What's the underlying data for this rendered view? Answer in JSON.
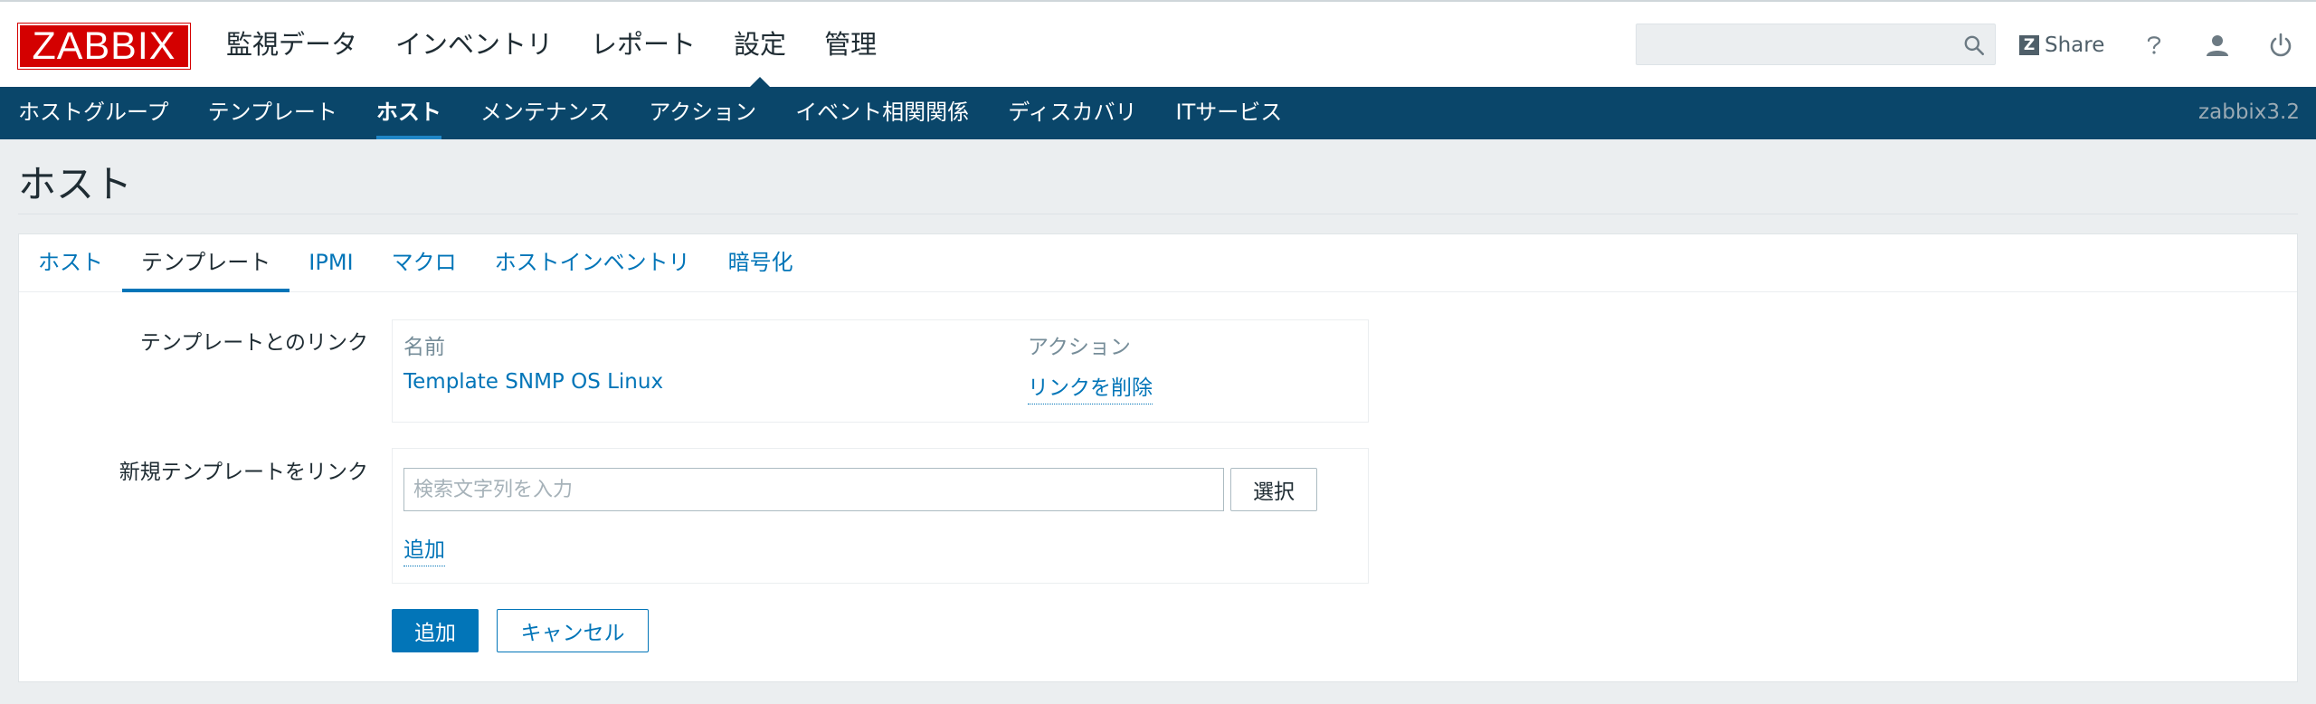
{
  "header": {
    "logo_text": "ZABBIX",
    "main_menu": [
      {
        "label": "監視データ"
      },
      {
        "label": "インベントリ"
      },
      {
        "label": "レポート"
      },
      {
        "label": "設定",
        "active": true
      },
      {
        "label": "管理"
      }
    ],
    "search": {
      "value": "",
      "placeholder": ""
    },
    "share_label": "Share",
    "help_icon": "question-mark",
    "user_icon": "person",
    "logout_icon": "power"
  },
  "submenu": {
    "items": [
      {
        "label": "ホストグループ"
      },
      {
        "label": "テンプレート"
      },
      {
        "label": "ホスト",
        "active": true
      },
      {
        "label": "メンテナンス"
      },
      {
        "label": "アクション"
      },
      {
        "label": "イベント相関関係"
      },
      {
        "label": "ディスカバリ"
      },
      {
        "label": "ITサービス"
      }
    ],
    "server_name": "zabbix3.2"
  },
  "page": {
    "title": "ホスト",
    "tabs": [
      {
        "label": "ホスト"
      },
      {
        "label": "テンプレート",
        "active": true
      },
      {
        "label": "IPMI"
      },
      {
        "label": "マクロ"
      },
      {
        "label": "ホストインベントリ"
      },
      {
        "label": "暗号化"
      }
    ]
  },
  "form": {
    "linked_templates": {
      "label": "テンプレートとのリンク",
      "col_name": "名前",
      "col_action": "アクション",
      "rows": [
        {
          "name": "Template SNMP OS Linux",
          "action": "リンクを削除"
        }
      ]
    },
    "link_new": {
      "label": "新規テンプレートをリンク",
      "input_value": "",
      "input_placeholder": "検索文字列を入力",
      "select_label": "選択",
      "add_link_label": "追加"
    },
    "buttons": {
      "add": "追加",
      "cancel": "キャンセル"
    }
  },
  "colors": {
    "logo_red": "#d40000",
    "submenu_bg": "#0a466a",
    "link_blue": "#0275b8",
    "page_bg": "#ebeef0"
  }
}
